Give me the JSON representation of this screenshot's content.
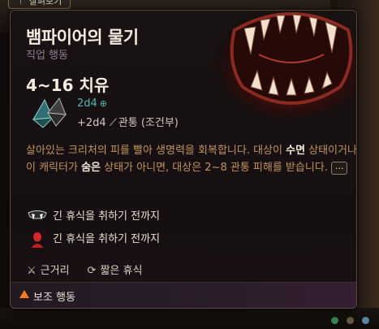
{
  "window_tab": {
    "label": "살펴보기"
  },
  "spell": {
    "name": "뱀파이어의 물기",
    "category": "직업 행동",
    "heal": "4~16 치유",
    "dice": "2d4",
    "bonus": "+2d4",
    "damage_type": "관통 (조건부)"
  },
  "description": {
    "part1": "살아있는 크리처의 피를 빨아 생명력을 회복합니다. 대상이 ",
    "kw1": "수면",
    "part2": " 상태이거나 이 캐릭터가 ",
    "kw2": "숨은",
    "part3": " 상태가 아니면, 대상은 2~8 관통 피해를 받습니다.",
    "more": "..."
  },
  "conditions": [
    {
      "icon": "fangs-icon",
      "text": "긴 휴식을 취하기 전까지"
    },
    {
      "icon": "red-head-icon",
      "text": "긴 휴식을 취하기 전까지"
    }
  ],
  "properties": {
    "range": "근거리",
    "recharge": "짧은 휴식"
  },
  "footer": {
    "action_type": "보조 행동"
  },
  "colors": {
    "accent_teal": "#55b8b0",
    "desc_gold": "#c4935a",
    "bonus_action": "#ff7a1e"
  }
}
